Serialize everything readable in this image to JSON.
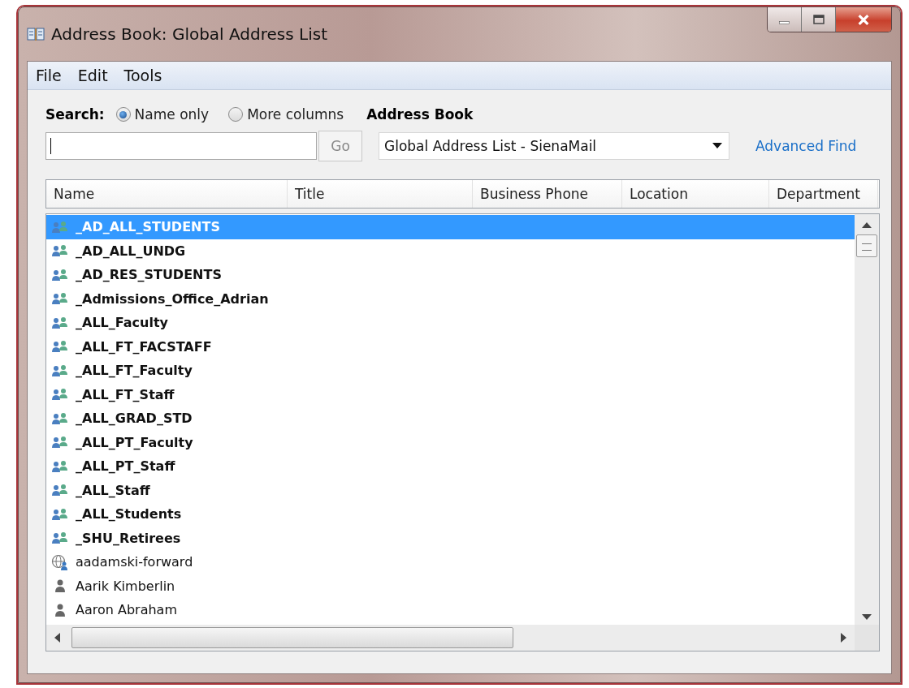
{
  "window": {
    "title": "Address Book: Global Address List"
  },
  "menu": [
    "File",
    "Edit",
    "Tools"
  ],
  "search": {
    "label": "Search:",
    "options": [
      {
        "label": "Name only",
        "selected": true
      },
      {
        "label": "More columns",
        "selected": false
      }
    ],
    "go": "Go"
  },
  "address_book": {
    "label": "Address Book",
    "value": "Global Address List - SienaMail"
  },
  "advanced_find": "Advanced Find",
  "table": {
    "columns": [
      "Name",
      "Title",
      "Business Phone",
      "Location",
      "Department"
    ],
    "rows": [
      {
        "name": "_AD_ALL_STUDENTS",
        "kind": "group",
        "selected": true
      },
      {
        "name": "_AD_ALL_UNDG",
        "kind": "group",
        "selected": false
      },
      {
        "name": "_AD_RES_STUDENTS",
        "kind": "group",
        "selected": false
      },
      {
        "name": "_Admissions_Office_Adrian",
        "kind": "group",
        "selected": false
      },
      {
        "name": "_ALL_Faculty",
        "kind": "group",
        "selected": false
      },
      {
        "name": "_ALL_FT_FACSTAFF",
        "kind": "group",
        "selected": false
      },
      {
        "name": "_ALL_FT_Faculty",
        "kind": "group",
        "selected": false
      },
      {
        "name": "_ALL_FT_Staff",
        "kind": "group",
        "selected": false
      },
      {
        "name": "_ALL_GRAD_STD",
        "kind": "group",
        "selected": false
      },
      {
        "name": "_ALL_PT_Faculty",
        "kind": "group",
        "selected": false
      },
      {
        "name": "_ALL_PT_Staff",
        "kind": "group",
        "selected": false
      },
      {
        "name": "_ALL_Staff",
        "kind": "group",
        "selected": false
      },
      {
        "name": "_ALL_Students",
        "kind": "group",
        "selected": false
      },
      {
        "name": "_SHU_Retirees",
        "kind": "group",
        "selected": false
      },
      {
        "name": "aadamski-forward",
        "kind": "external",
        "selected": false
      },
      {
        "name": "Aarik Kimberlin",
        "kind": "user",
        "selected": false
      },
      {
        "name": "Aaron Abraham",
        "kind": "user",
        "selected": false
      }
    ]
  }
}
